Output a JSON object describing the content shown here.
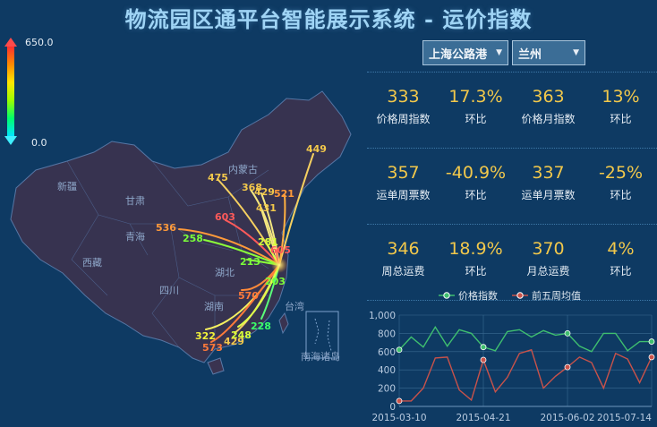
{
  "title": "物流园区通平台智能展示系统 - 运价指数",
  "legend": {
    "max": "650.0",
    "min": "0.0"
  },
  "selects": {
    "route": "上海公路港",
    "city": "兰州"
  },
  "map": {
    "province_labels": [
      "新疆",
      "西藏",
      "青海",
      "甘肃",
      "内蒙古",
      "四川",
      "湖北",
      "湖南",
      "台湾",
      "南海诸岛"
    ],
    "flow_values": [
      {
        "value": "449",
        "color": "#f2c84b"
      },
      {
        "value": "475",
        "color": "#f2c84b"
      },
      {
        "value": "368",
        "color": "#f2c84b"
      },
      {
        "value": "429",
        "color": "#f2c84b"
      },
      {
        "value": "521",
        "color": "#ff9a3a"
      },
      {
        "value": "431",
        "color": "#f2c84b"
      },
      {
        "value": "536",
        "color": "#ff9a3a"
      },
      {
        "value": "258",
        "color": "#7bff3a"
      },
      {
        "value": "603",
        "color": "#ff5a5a"
      },
      {
        "value": "281",
        "color": "#d8ff3a"
      },
      {
        "value": "605",
        "color": "#ff5a5a"
      },
      {
        "value": "213",
        "color": "#7bff3a"
      },
      {
        "value": "203",
        "color": "#7bff3a"
      },
      {
        "value": "570",
        "color": "#ff7a3a"
      },
      {
        "value": "228",
        "color": "#3aff6a"
      },
      {
        "value": "322",
        "color": "#f2f23a"
      },
      {
        "value": "573",
        "color": "#ff7a3a"
      },
      {
        "value": "429",
        "color": "#f2c84b"
      },
      {
        "value": "248",
        "color": "#d8ff3a"
      }
    ]
  },
  "stats": [
    [
      {
        "value": "333",
        "label": "价格周指数"
      },
      {
        "value": "17.3%",
        "label": "环比"
      },
      {
        "value": "363",
        "label": "价格月指数"
      },
      {
        "value": "13%",
        "label": "环比"
      }
    ],
    [
      {
        "value": "357",
        "label": "运单周票数"
      },
      {
        "value": "-40.9%",
        "label": "环比"
      },
      {
        "value": "337",
        "label": "运单月票数"
      },
      {
        "value": "-25%",
        "label": "环比"
      }
    ],
    [
      {
        "value": "346",
        "label": "周总运费"
      },
      {
        "value": "18.9%",
        "label": "环比"
      },
      {
        "value": "370",
        "label": "月总运费"
      },
      {
        "value": "4%",
        "label": "环比"
      }
    ]
  ],
  "colors": {
    "series1": "#3fbf6f",
    "series2": "#c9524a",
    "value": "#f2c84b"
  },
  "chart_data": {
    "type": "line",
    "xlabels": [
      "2015-03-10",
      "2015-04-21",
      "2015-06-02",
      "2015-07-14"
    ],
    "ylim": [
      0,
      1000
    ],
    "yticks": [
      "0",
      "200",
      "400",
      "600",
      "800",
      "1,000"
    ],
    "legend_position": "top",
    "series": [
      {
        "name": "价格指数",
        "values": [
          620,
          760,
          650,
          870,
          660,
          840,
          800,
          650,
          610,
          820,
          840,
          760,
          830,
          780,
          800,
          660,
          600,
          800,
          800,
          610,
          710,
          710
        ]
      },
      {
        "name": "前五周均值",
        "values": [
          60,
          60,
          200,
          530,
          540,
          180,
          70,
          510,
          160,
          320,
          580,
          620,
          200,
          330,
          430,
          540,
          480,
          200,
          580,
          520,
          260,
          540
        ]
      }
    ]
  }
}
